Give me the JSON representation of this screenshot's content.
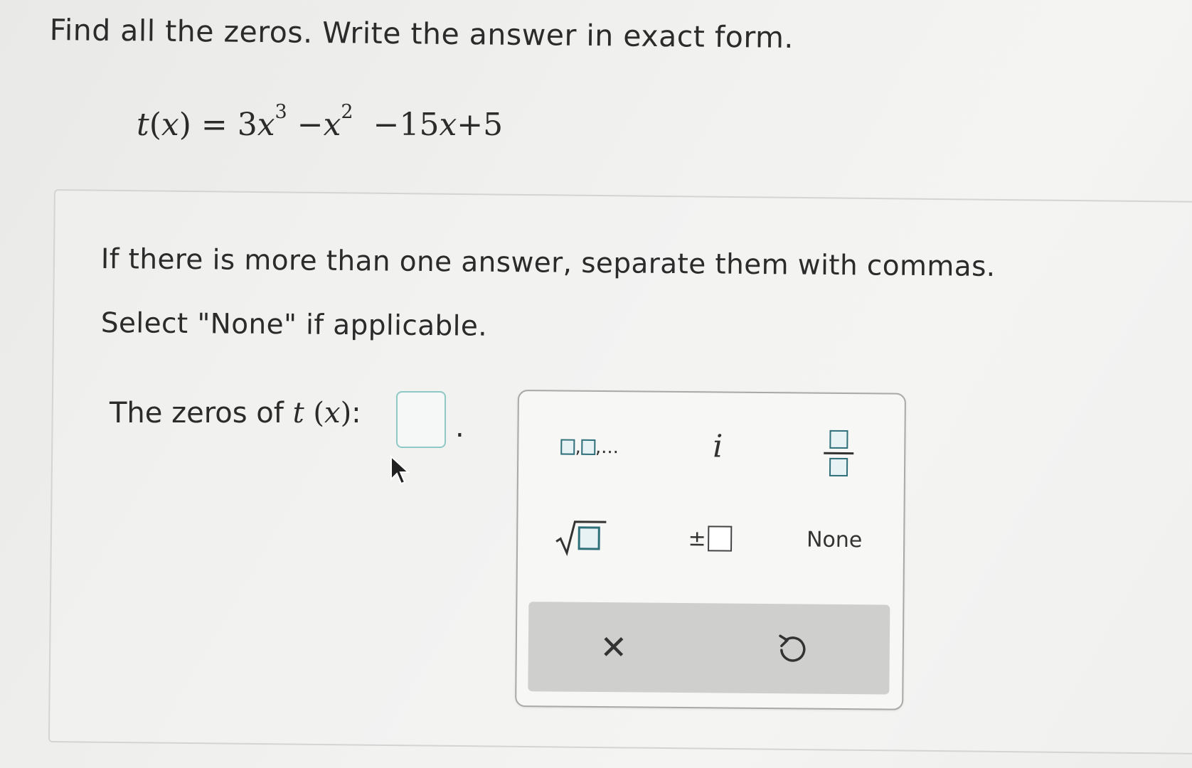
{
  "question": {
    "instruction": "Find all the zeros. Write the answer in exact form.",
    "equation": {
      "function_name": "t",
      "variable": "x",
      "rhs_terms": [
        "3",
        "x",
        "3",
        "−",
        "x",
        "2",
        "−15",
        "x",
        "+5"
      ]
    }
  },
  "answer_area": {
    "hint_line1": "If there is more than one answer, separate them with commas.",
    "hint_line2": "Select \"None\" if applicable.",
    "zeros_label_prefix": "The zeros of",
    "zeros_fn": "t",
    "zeros_var": "x",
    "answer_value": "",
    "trailing_period": "."
  },
  "keypad": {
    "list_key_suffix": ",...",
    "imaginary_key": "i",
    "plus_minus_symbol": "±",
    "none_key": "None",
    "clear_key": "✕",
    "undo_icon": "undo-icon"
  },
  "colors": {
    "box_border": "#2f6f7a",
    "input_border": "#8fc9c5",
    "action_bar": "#cfd0ce"
  }
}
